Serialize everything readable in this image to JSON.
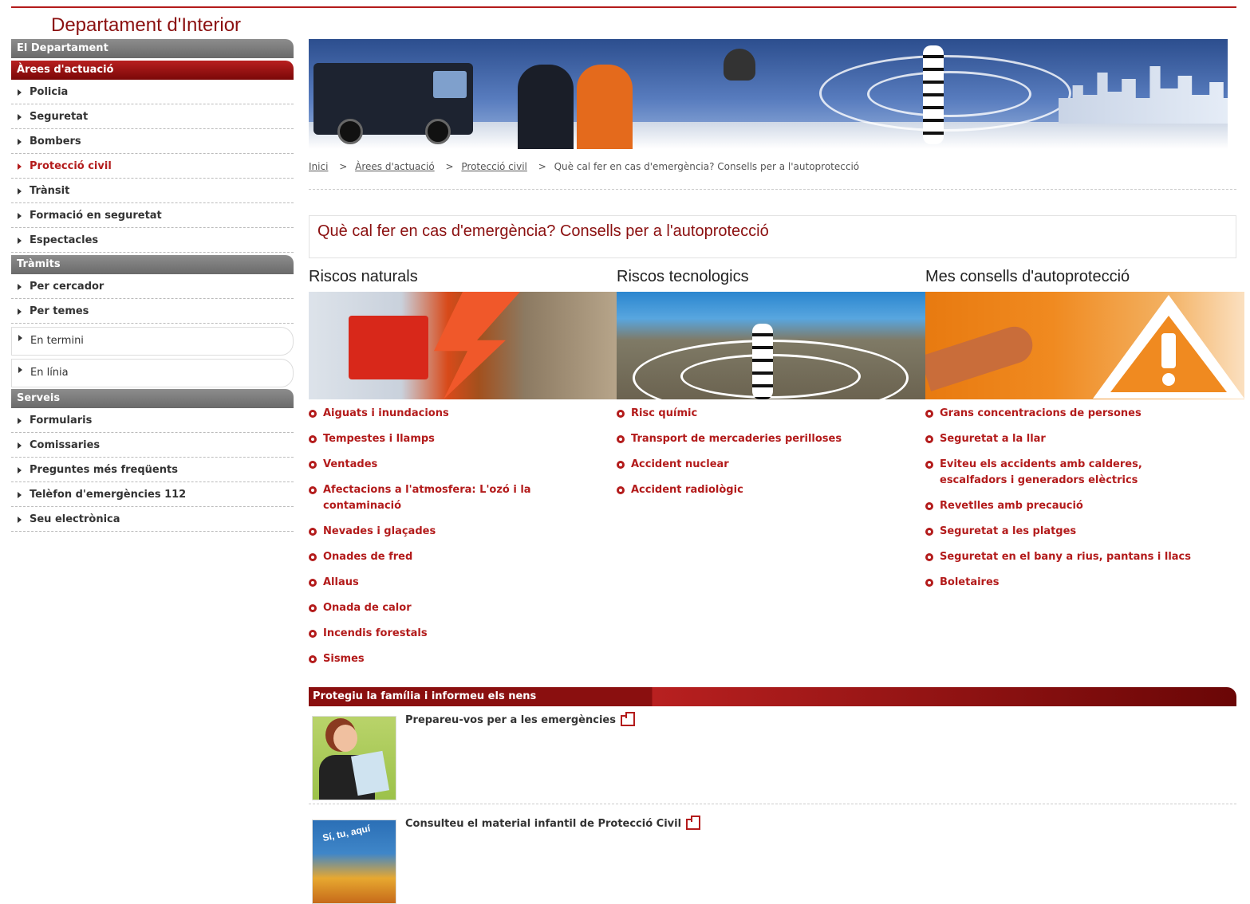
{
  "site": {
    "title": "Departament d'Interior"
  },
  "sidebar": {
    "sections": [
      {
        "title": "El Departament",
        "active": false,
        "items": []
      },
      {
        "title": "Àrees d'actuació",
        "active": true,
        "items": [
          {
            "label": "Policia"
          },
          {
            "label": "Seguretat"
          },
          {
            "label": "Bombers"
          },
          {
            "label": "Protecció civil",
            "current": true
          },
          {
            "label": "Trànsit"
          },
          {
            "label": "Formació en seguretat"
          },
          {
            "label": "Espectacles"
          }
        ]
      },
      {
        "title": "Tràmits",
        "active": false,
        "items": [
          {
            "label": "Per cercador"
          },
          {
            "label": "Per temes"
          },
          {
            "label": "En termini"
          },
          {
            "label": "En línia"
          }
        ]
      },
      {
        "title": "Serveis",
        "active": false,
        "items": [
          {
            "label": "Formularis"
          },
          {
            "label": "Comissaries"
          },
          {
            "label": "Preguntes més freqüents"
          },
          {
            "label": "Telèfon d'emergències 112"
          },
          {
            "label": "Seu electrònica"
          }
        ]
      }
    ]
  },
  "breadcrumb": {
    "items": [
      "Inici",
      "Àrees d'actuació",
      "Protecció civil"
    ],
    "current": "Què cal fer en cas d'emergència? Consells per a l'autoprotecció",
    "separator": ">"
  },
  "page": {
    "title": "Què cal fer en cas d'emergència? Consells per a l'autoprotecció"
  },
  "columns": [
    {
      "heading": "Riscos naturals",
      "image_icon": "natural-risks-image",
      "links": [
        "Aiguats i inundacions",
        "Tempestes i llamps",
        "Ventades",
        "Afectacions a l'atmosfera: L'ozó i la contaminació",
        "Nevades i glaçades",
        "Onades de fred",
        "Allaus",
        "Onada de calor",
        "Incendis forestals",
        "Sismes"
      ]
    },
    {
      "heading": "Riscos tecnologics",
      "image_icon": "technological-risks-image",
      "links": [
        "Risc químic",
        "Transport de mercaderies perilloses",
        "Accident nuclear",
        "Accident radiològic"
      ]
    },
    {
      "heading": "Mes consells d'autoprotecció",
      "image_icon": "warning-sign-image",
      "links": [
        "Grans concentracions de persones",
        "Seguretat a la llar",
        "Eviteu els accidents amb calderes, escalfadors i generadors elèctrics",
        "Revetlles amb precaució",
        "Seguretat a les platges",
        "Seguretat en el bany a rius, pantans i llacs",
        "Boletaires"
      ]
    }
  ],
  "family": {
    "heading": "Protegiu la família i informeu els nens",
    "items": [
      {
        "label": "Prepareu-vos per a les emergències",
        "thumb_icon": "woman-reading-illustration"
      },
      {
        "label": "Consulteu el material infantil de Protecció Civil",
        "thumb_icon": "children-material-illustration",
        "thumb_text": "Sí, tu, aquí"
      }
    ]
  },
  "colors": {
    "brand_red": "#b31b1b",
    "title_red": "#8b1010",
    "header_gray": "#7a7a7a"
  }
}
